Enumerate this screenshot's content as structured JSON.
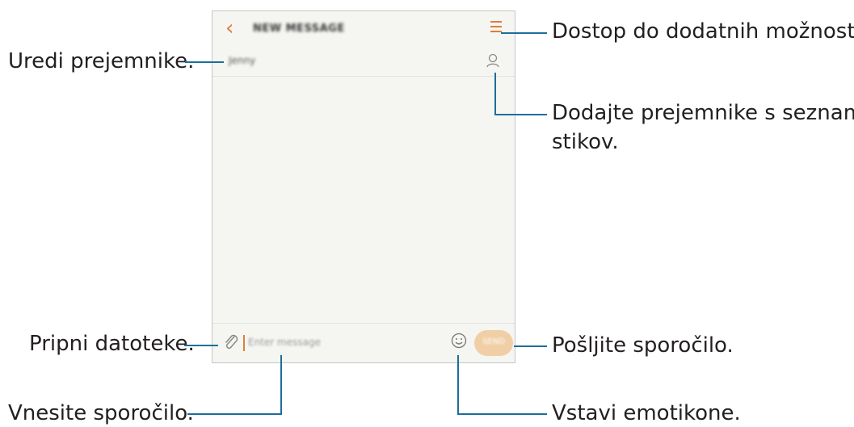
{
  "screen": {
    "title": "NEW MESSAGE",
    "recipient": "Jenny",
    "message_placeholder": "Enter message",
    "send_label": "SEND",
    "accent_color": "#e07d3c",
    "send_button_color": "#f1cfa6"
  },
  "icons": {
    "back": "back-arrow-icon",
    "menu": "menu-icon",
    "contacts": "contact-person-icon",
    "attach": "paperclip-icon",
    "emoji": "smiley-icon"
  },
  "callouts": {
    "more_options": "Dostop do dodatnih možnosti.",
    "edit_recipients": "Uredi prejemnike.",
    "add_from_contacts_line1": "Dodajte prejemnike s seznama",
    "add_from_contacts_line2": "stikov.",
    "attach_files": "Pripni datoteke.",
    "send_message": "Pošljite sporočilo.",
    "enter_message": "Vnesite sporočilo.",
    "insert_emoticons": "Vstavi emotikone."
  },
  "callout_line_color": "#1b6f9c"
}
